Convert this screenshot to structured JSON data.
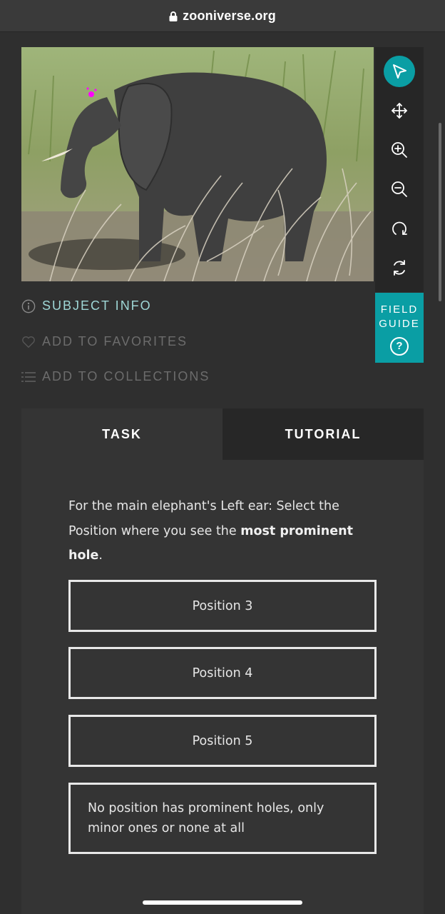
{
  "browser": {
    "domain": "zooniverse.org",
    "lock_icon": "lock-icon"
  },
  "toolbar": {
    "tools": [
      {
        "name": "pointer-icon",
        "active": true
      },
      {
        "name": "move-icon"
      },
      {
        "name": "zoom-in-icon"
      },
      {
        "name": "zoom-out-icon"
      },
      {
        "name": "rotate-icon"
      },
      {
        "name": "reset-icon"
      }
    ],
    "accent": "#0a9ea4"
  },
  "field_guide": {
    "label": "FIELD GUIDE",
    "help": "?"
  },
  "subject_meta": {
    "info": "SUBJECT INFO",
    "favorites": "ADD TO FAVORITES",
    "collections": "ADD TO COLLECTIONS"
  },
  "tabs": {
    "task": "TASK",
    "tutorial": "TUTORIAL"
  },
  "question": {
    "prefix": "For the main elephant's Left ear: Select the Position where you see the ",
    "bold1": "most prominent",
    "middle": " ",
    "bold2": "hole",
    "suffix": "."
  },
  "answers": [
    "Position 3",
    "Position 4",
    "Position 5",
    "No position has prominent holes, only minor ones or none at all"
  ]
}
